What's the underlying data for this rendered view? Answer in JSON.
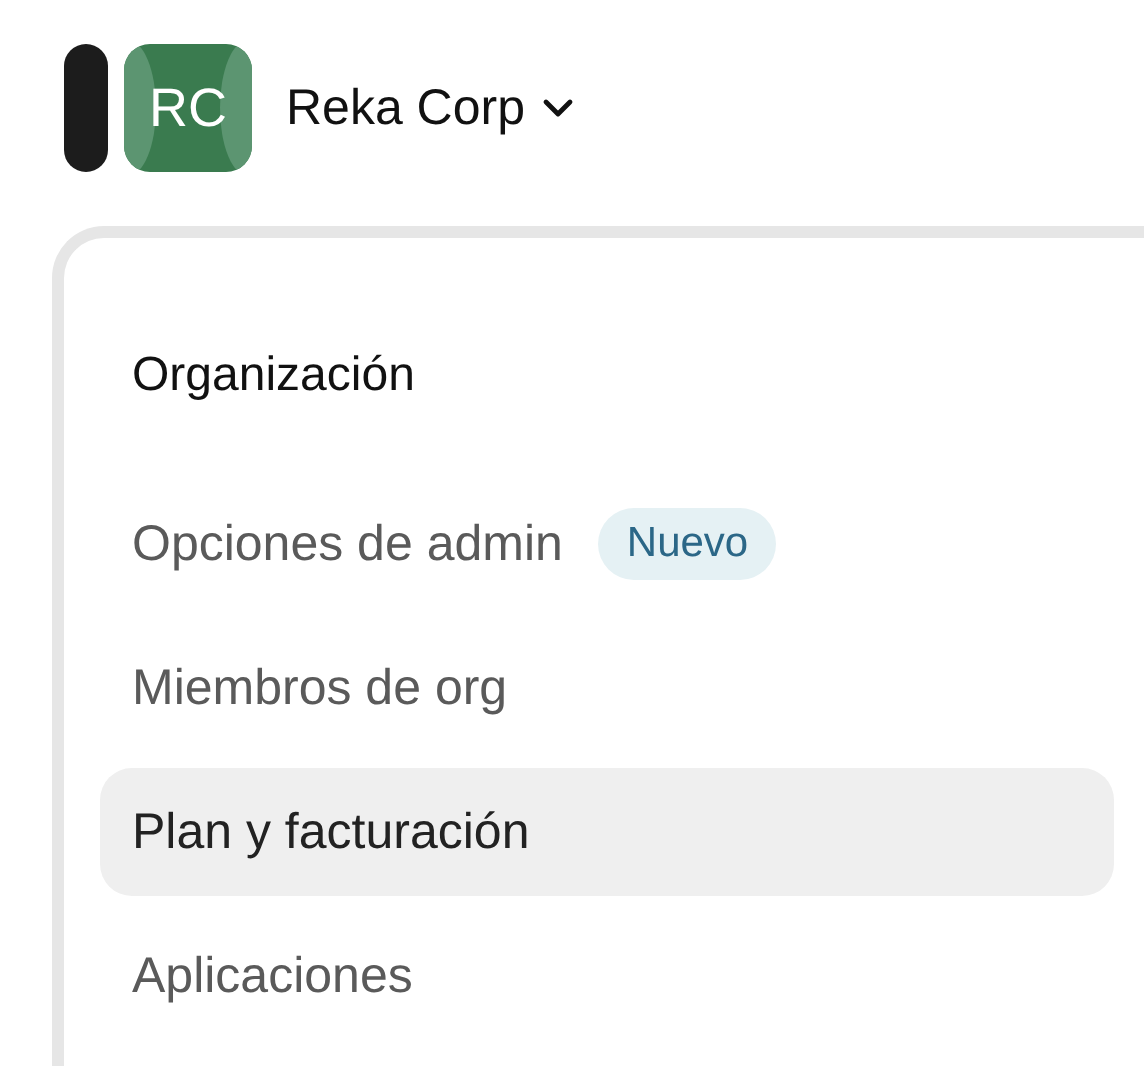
{
  "org": {
    "initials": "RC",
    "name": "Reka Corp"
  },
  "section": {
    "title": "Organización"
  },
  "items": [
    {
      "label": "Opciones de admin",
      "badge": "Nuevo",
      "selected": false
    },
    {
      "label": "Miembros de org",
      "selected": false
    },
    {
      "label": "Plan y facturación",
      "selected": true
    },
    {
      "label": "Aplicaciones",
      "selected": false
    }
  ]
}
